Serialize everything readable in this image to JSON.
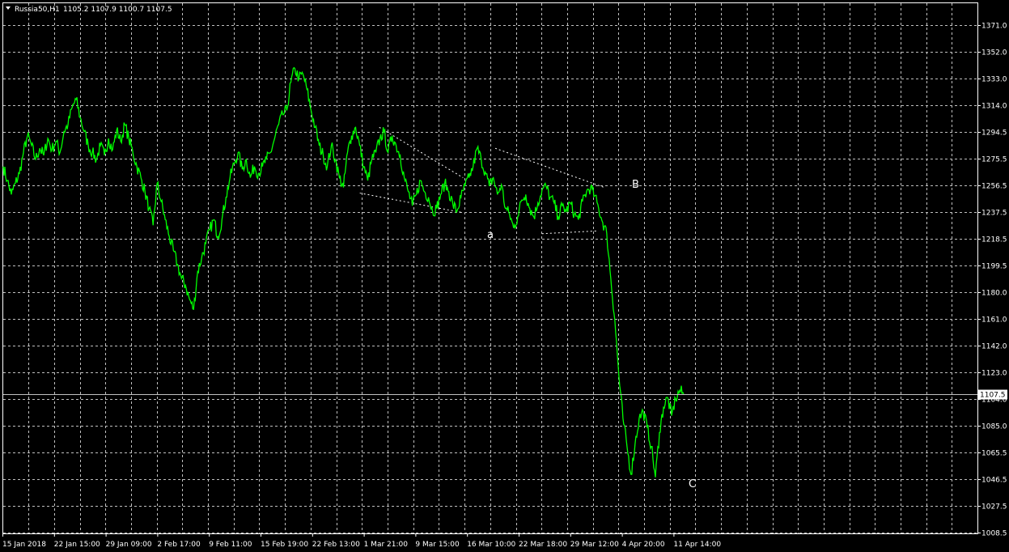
{
  "header": {
    "symbol": "Russia50,H1",
    "ohlc": "1105.2 1107.9 1100.7 1107.5"
  },
  "colors": {
    "background": "#000000",
    "grid": "#c0c0c0",
    "price_line": "#00ff00",
    "frame": "#ffffff",
    "current_price_line": "#c0c0c0"
  },
  "chart_data": {
    "type": "line",
    "ylim": [
      1008.5,
      1381.0
    ],
    "yticks": [
      "1371.0",
      "1352.0",
      "1333.0",
      "1314.0",
      "1294.5",
      "1275.5",
      "1256.5",
      "1237.5",
      "1218.5",
      "1199.5",
      "1180.0",
      "1161.0",
      "1142.0",
      "1123.0",
      "1104.0",
      "1085.0",
      "1065.5",
      "1046.5",
      "1027.5",
      "1008.5"
    ],
    "xticks": [
      "15 Jan 2018",
      "22 Jan 15:00",
      "29 Jan 09:00",
      "2 Feb 17:00",
      "9 Feb 11:00",
      "15 Feb 19:00",
      "22 Feb 13:00",
      "1 Mar 21:00",
      "9 Mar 15:00",
      "16 Mar 10:00",
      "22 Mar 18:00",
      "29 Mar 12:00",
      "4 Apr 20:00",
      "11 Apr 14:00"
    ],
    "current_price": 1107.5,
    "current_price_label": "1107.5",
    "grid": true,
    "series": [
      {
        "values": [
          1270,
          1260,
          1250,
          1258,
          1265,
          1280,
          1292,
          1285,
          1275,
          1283,
          1278,
          1290,
          1282,
          1288,
          1280,
          1295,
          1300,
          1312,
          1318,
          1305,
          1295,
          1285,
          1280,
          1275,
          1285,
          1278,
          1290,
          1282,
          1296,
          1288,
          1300,
          1290,
          1280,
          1270,
          1262,
          1252,
          1240,
          1228,
          1258,
          1245,
          1232,
          1220,
          1210,
          1200,
          1190,
          1185,
          1175,
          1168,
          1195,
          1205,
          1215,
          1225,
          1232,
          1220,
          1232,
          1248,
          1262,
          1272,
          1280,
          1268,
          1275,
          1262,
          1270,
          1265,
          1270,
          1275,
          1280,
          1290,
          1300,
          1307,
          1310,
          1330,
          1340,
          1333,
          1336,
          1325,
          1310,
          1298,
          1285,
          1278,
          1270,
          1285,
          1275,
          1262,
          1255,
          1280,
          1292,
          1298,
          1285,
          1270,
          1260,
          1275,
          1280,
          1290,
          1295,
          1280,
          1292,
          1285,
          1278,
          1262,
          1252,
          1242,
          1250,
          1260,
          1252,
          1248,
          1238,
          1240,
          1250,
          1258,
          1252,
          1243,
          1238,
          1248,
          1256,
          1262,
          1270,
          1283,
          1275,
          1266,
          1256,
          1262,
          1250,
          1257,
          1240,
          1236,
          1226,
          1234,
          1246,
          1250,
          1240,
          1234,
          1244,
          1253,
          1256,
          1248,
          1244,
          1234,
          1242,
          1238,
          1244,
          1236,
          1232,
          1245,
          1252,
          1255,
          1249,
          1240,
          1230,
          1222,
          1190,
          1160,
          1120,
          1090,
          1070,
          1050,
          1072,
          1090,
          1095,
          1084,
          1070,
          1048,
          1080,
          1098,
          1105,
          1092,
          1104,
          1110,
          1107.5
        ],
        "note_values_are_index_spaced": true
      }
    ],
    "overlays": {
      "labels": [
        "a",
        "B",
        "C"
      ],
      "dotted_lines": [
        {
          "from": [
            0.366,
            1251
          ],
          "to": [
            0.472,
            1237
          ]
        },
        {
          "from": [
            0.386,
            1298
          ],
          "to": [
            0.472,
            1262
          ]
        },
        {
          "from": [
            0.505,
            1283
          ],
          "to": [
            0.617,
            1255
          ]
        },
        {
          "from": [
            0.553,
            1222
          ],
          "to": [
            0.61,
            1224
          ]
        }
      ]
    }
  }
}
